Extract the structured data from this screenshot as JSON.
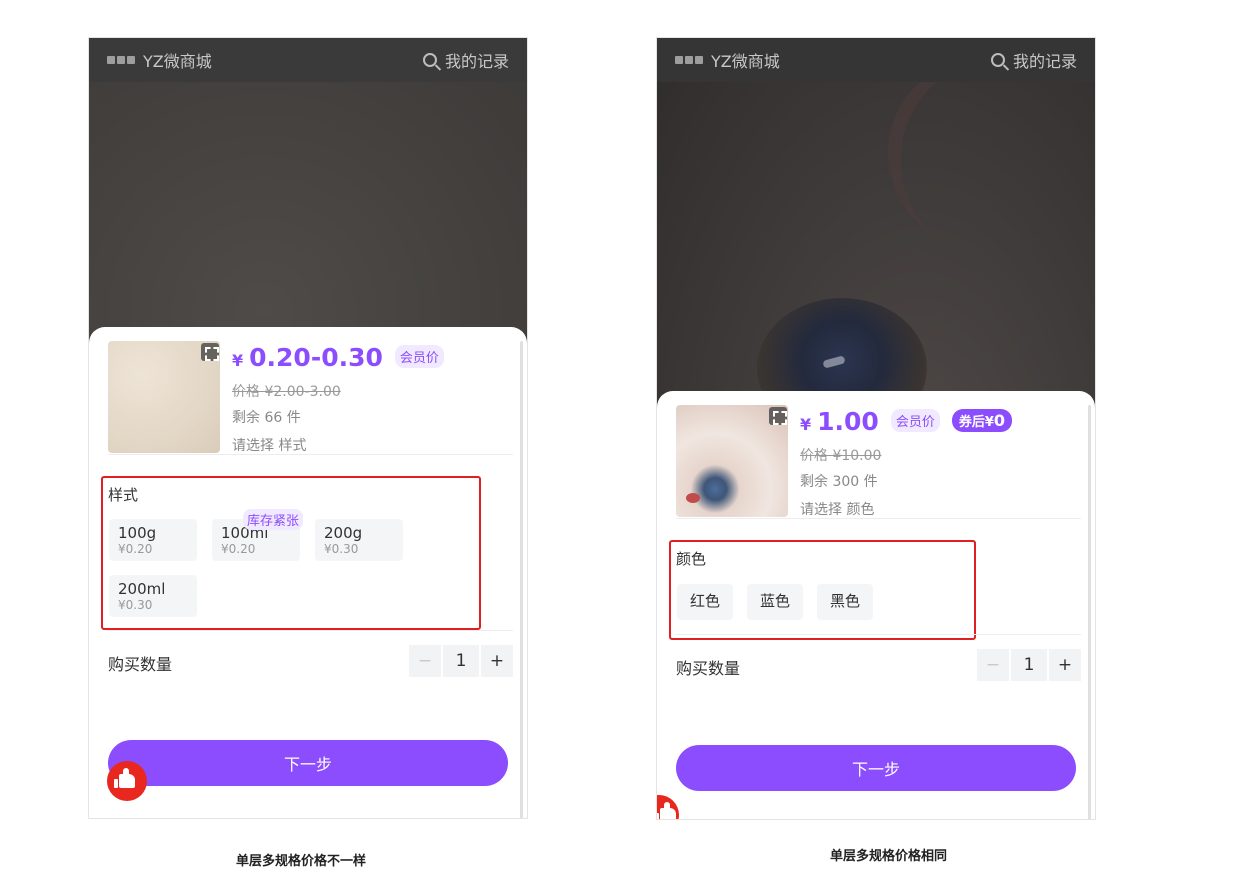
{
  "header": {
    "shop_name": "YZ微商城",
    "records_label": "我的记录"
  },
  "left_screen": {
    "currency": "¥",
    "price_range": "0.20-0.30",
    "member_tag": "会员价",
    "original_price": "价格 ¥2.00-3.00",
    "stock": "剩余 66 件",
    "select_hint": "请选择 样式",
    "property_title": "样式",
    "options": [
      {
        "label": "100g",
        "price": "¥0.20"
      },
      {
        "label": "100ml",
        "price": "¥0.20",
        "badge": "库存紧张"
      },
      {
        "label": "200g",
        "price": "¥0.30"
      },
      {
        "label": "200ml",
        "price": "¥0.30"
      }
    ],
    "quantity_label": "购买数量",
    "quantity": "1",
    "minus": "−",
    "plus": "+",
    "next_button": "下一步",
    "caption": "单层多规格价格不一样"
  },
  "right_screen": {
    "currency": "¥",
    "price": "1.00",
    "member_tag": "会员价",
    "coupon_prefix": "券后",
    "coupon_currency": "¥",
    "coupon_value": "0",
    "original_price": "价格 ¥10.00",
    "stock": "剩余 300 件",
    "select_hint": "请选择 颜色",
    "property_title": "颜色",
    "options": [
      {
        "label": "红色"
      },
      {
        "label": "蓝色"
      },
      {
        "label": "黑色"
      }
    ],
    "quantity_label": "购买数量",
    "quantity": "1",
    "minus": "−",
    "plus": "+",
    "next_button": "下一步",
    "caption": "单层多规格价格相同"
  },
  "colors": {
    "accent": "#8c4dff",
    "highlight_box": "#e02020",
    "like_button": "#e8271e"
  }
}
